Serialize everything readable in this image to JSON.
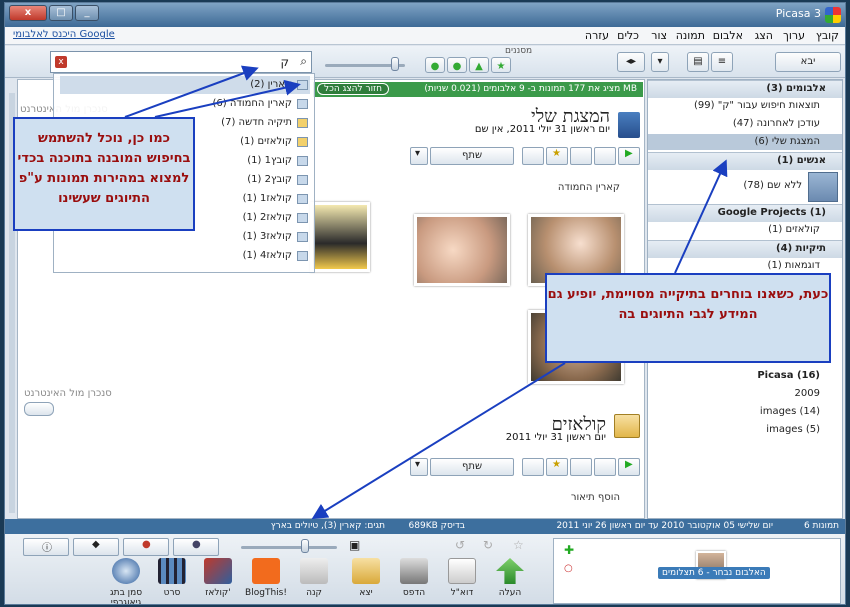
{
  "window": {
    "title": "Picasa 3",
    "close_label": "x",
    "max_label": "□",
    "min_label": "_"
  },
  "menu": {
    "items": [
      "קובץ",
      "ערוך",
      "הצג",
      "אלבום",
      "תמונה",
      "צור",
      "כלים",
      "עזרה"
    ],
    "google_link": "היכנס לאלבומי Google"
  },
  "toolbar": {
    "import_label": "יבא",
    "tags_label": "מסננים"
  },
  "search": {
    "value": "ק"
  },
  "greenbar": {
    "text": "מציג את 177 תמונות ב- 9 אלבומים (0.021 שניות) MB",
    "back_button": "חזור להצג הכל"
  },
  "sidebar": {
    "albums_header": "אלבומים (3)",
    "albums": [
      "תוצאות חיפוש עבור \"ק\" (99)",
      "עודכן לאחרונה (47)",
      "המצגת שלי (6)"
    ],
    "people_header": "אנשים (1)",
    "people": [
      "ללא שם (78)"
    ],
    "projects_header": "Google Projects (1)",
    "projects": [
      "קולאזים (1)"
    ],
    "folders_header": "תיקיות (4)",
    "folders": [
      "דוגמאות (1)"
    ],
    "picasa_folder": "Picasa (16)",
    "year": "2009",
    "images_1": "images (14)",
    "images_2": "images (5)"
  },
  "dropdown": {
    "items": [
      "קארין (2)",
      "קארין החמודה (6)",
      "תיקיה חדשה (7)",
      "קולאזים (1)",
      "קובץ1 (1)",
      "קובץ2 (1)",
      "קולאז1 (1)",
      "קולאז2 (1)",
      "קולאז3 (1)",
      "קולאז4 (1)"
    ]
  },
  "main": {
    "album1_title": "המצגת שלי",
    "album1_date": "יום ראשון 31 יולי 2011, אין שם",
    "share_label": "שתף",
    "section1_label": "קארין החמודה",
    "album2_title": "קולאזים",
    "album2_date": "יום ראשון 31 יולי 2011",
    "add_desc": "הוסף תיאור",
    "side_sync": "סנכרן מול האינטרנט",
    "side_sync_top": "סנכרן מול האינטרנט"
  },
  "callouts": {
    "left": "כמו כן, נוכל להשתמש בחיפוש המובנה בתוכנה בכדי למצוא במהירות תמונות ע\"פ התיוגים שעשינו",
    "right": "כעת, כשאנו בוחרים בתיקייה מסויימת, יופיע גם המידע לגבי התיוגים בה"
  },
  "status": {
    "count": "6 תמונות",
    "dates": "יום שלישי 05 אוקטובר 2010 עד יום ראשון 26 יוני 2011",
    "disk": "689KB בדיסק",
    "tags": "תגים: קארין (3), טיולים בארץ"
  },
  "bottom": {
    "buttons": [
      "העלה",
      "דוא\"ל",
      "הדפס",
      "יצא",
      "קנה",
      "BlogThis!",
      "קולאז'",
      "סרט",
      "סמן בתג גיאוגרפי"
    ],
    "tray_label": "האלבום נבחר - 6 תצלומים"
  },
  "colors": {
    "green": "#3b9a4a",
    "callout_border": "#1a3fc0",
    "callout_text": "#9a0e0e",
    "status": "#3d6f9e"
  }
}
